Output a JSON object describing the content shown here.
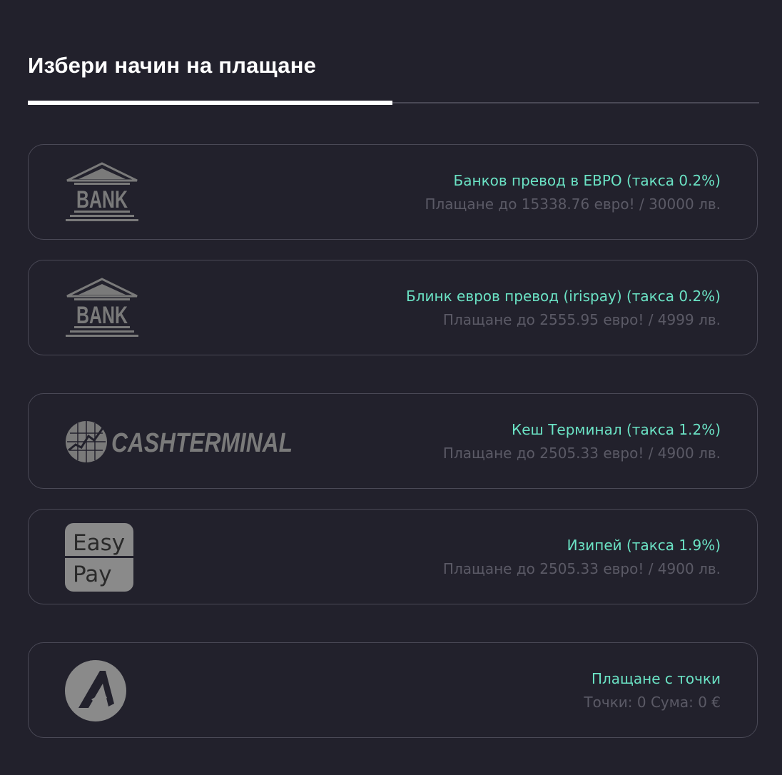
{
  "header": {
    "title": "Избери начин на плащане"
  },
  "colors": {
    "background": "#22212c",
    "accent": "#6be3c5",
    "muted": "#5b5a66",
    "border": "#4a4956",
    "logo_gray": "#7a7a7a"
  },
  "methods": [
    {
      "title": "Банков превод в ЕВРО (такса 0.2%)",
      "limit": "Плащане до 15338.76 евро! / 30000 лв.",
      "logo": "bank-logo",
      "logo_text": "BANK"
    },
    {
      "title": "Блинк евров превод (irispay) (такса 0.2%)",
      "limit": "Плащане до 2555.95 евро! / 4999 лв.",
      "logo": "bank-logo",
      "logo_text": "BANK"
    },
    {
      "title": "Кеш Терминал (такса 1.2%)",
      "limit": "Плащане до 2505.33 евро! / 4900 лв.",
      "logo": "cashterminal-logo",
      "logo_text": "CASHTERMINAL"
    },
    {
      "title": "Изипей (такса 1.9%)",
      "limit": "Плащане до 2505.33 евро! / 4900 лв.",
      "logo": "easypay-logo",
      "logo_text_top": "Easy",
      "logo_text_bottom": "Pay"
    },
    {
      "title": "Плащане с точки",
      "limit": "Точки: 0 Сума: 0 €",
      "logo": "points-logo"
    }
  ]
}
